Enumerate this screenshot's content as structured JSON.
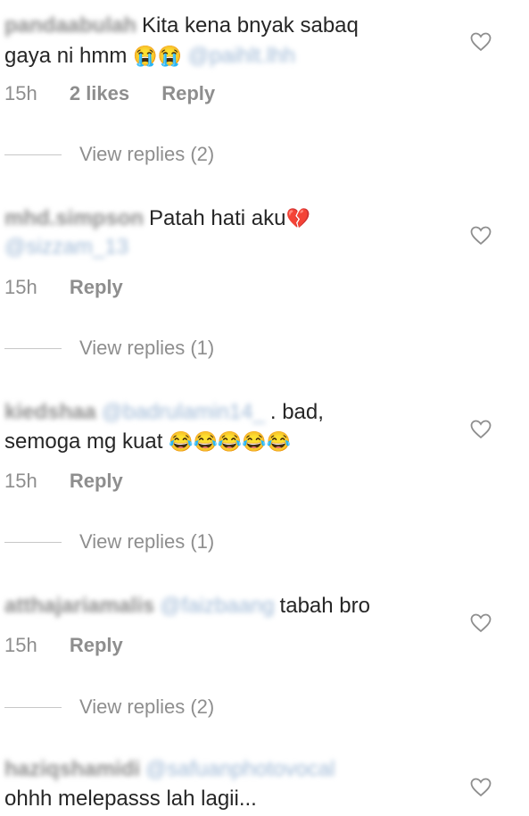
{
  "comments": [
    {
      "username": "pandaabulah",
      "mention": "@paihlt.lhh",
      "text_line1": "Kita kena bnyak sabaq",
      "text_line2": "gaya ni hmm",
      "emoji": "😭😭",
      "time": "15h",
      "likes": "2 likes",
      "reply_label": "Reply",
      "view_replies": "View replies (2)"
    },
    {
      "username": "mhd.simpson",
      "mention": "@sizzam_13",
      "text_line1": "Patah hati aku",
      "emoji": "💔",
      "time": "15h",
      "reply_label": "Reply",
      "view_replies": "View replies (1)"
    },
    {
      "username": "kiedshaa",
      "mention": "@badrulamin14_",
      "text_line1": ". bad,",
      "text_line2": "semoga mg kuat",
      "emoji": "😂😂😂😂😂",
      "time": "15h",
      "reply_label": "Reply",
      "view_replies": "View replies (1)"
    },
    {
      "username": "atthajariamalis",
      "mention": "@faizbaang",
      "text_line1": "tabah bro",
      "time": "15h",
      "reply_label": "Reply",
      "view_replies": "View replies (2)"
    },
    {
      "username": "haziqshamidi",
      "mention": "@safuanphotovocal",
      "text_line2": "ohhh melepasss lah lagii..."
    }
  ]
}
